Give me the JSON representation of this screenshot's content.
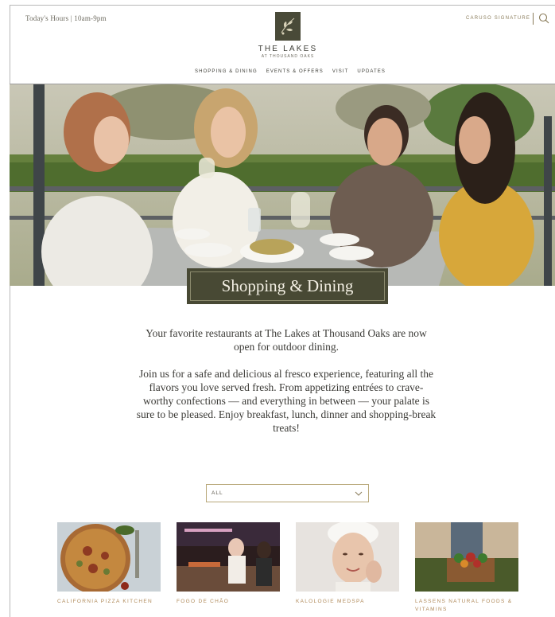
{
  "header": {
    "hours": "Today's Hours | 10am-9pm",
    "signature_link": "CARUSO SIGNATURE",
    "logo_title": "THE LAKES",
    "logo_subtitle": "AT THOUSAND OAKS",
    "search_icon": "search-icon"
  },
  "nav": {
    "items": [
      "SHOPPING & DINING",
      "EVENTS & OFFERS",
      "VISIT",
      "UPDATES"
    ]
  },
  "hero": {
    "title": "Shopping & Dining",
    "image": "group of friends dining outdoors"
  },
  "intro": {
    "paragraph1": "Your favorite restaurants at The Lakes at Thousand Oaks are now open for outdoor dining.",
    "paragraph2": "Join us for a safe and delicious al fresco experience, featuring all the flavors you love served fresh. From appetizing entrées to crave-worthy confections — and everything in between — your palate is sure to be pleased. Enjoy breakfast, lunch, dinner and shopping-break treats!"
  },
  "filter": {
    "selected": "ALL",
    "icon": "chevron-down-icon"
  },
  "cards": [
    {
      "label": "CALIFORNIA PIZZA KITCHEN",
      "image": "pizza"
    },
    {
      "label": "FOGO DE CHÃO",
      "image": "restaurant kitchen"
    },
    {
      "label": "KALOLOGIE MEDSPA",
      "image": "spa face"
    },
    {
      "label": "LASSENS NATURAL FOODS & VITAMINS",
      "image": "vegetable crate"
    }
  ],
  "colors": {
    "brand_olive": "#484934",
    "accent_gold": "#b08a5a",
    "text": "#3b3a36"
  }
}
